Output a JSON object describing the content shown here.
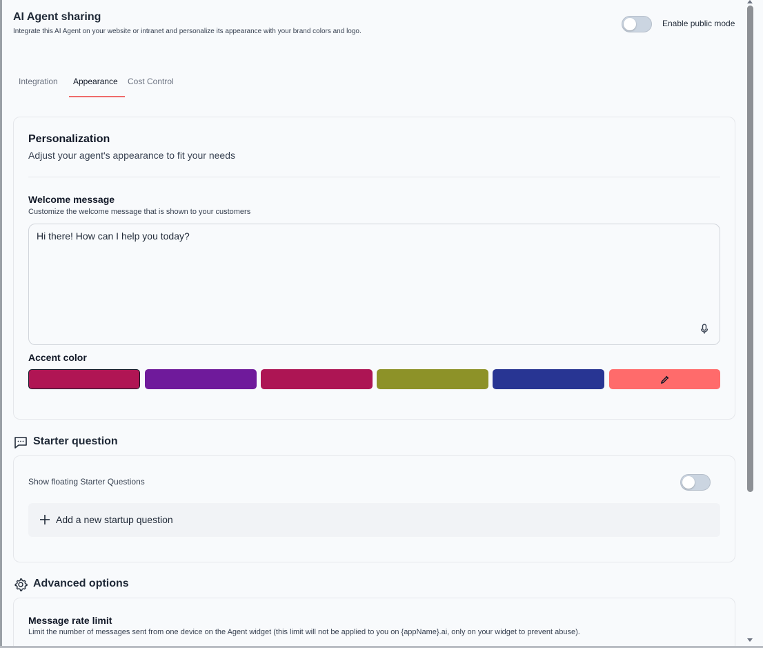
{
  "header": {
    "title": "AI Agent sharing",
    "subtitle": "Integrate this AI Agent on your website or intranet and personalize its appearance with your brand colors and logo.",
    "public_mode_label": "Enable public mode",
    "public_mode_enabled": false
  },
  "tabs": [
    {
      "label": "Integration",
      "active": false
    },
    {
      "label": "Appearance",
      "active": true
    },
    {
      "label": "Cost Control",
      "active": false
    }
  ],
  "personalization": {
    "title": "Personalization",
    "subtitle": "Adjust your agent's appearance to fit your needs",
    "welcome": {
      "title": "Welcome message",
      "subtitle": "Customize the welcome message that is shown to your customers",
      "value": "Hi there! How can I help you today?",
      "mic_icon": "microphone-icon"
    },
    "accent": {
      "title": "Accent color",
      "swatches": [
        "#b01554",
        "#6f1a9b",
        "#ad1554",
        "#8d9228",
        "#283593",
        "#ff6b6b"
      ],
      "selected_index": 0,
      "picker_icon": "eyedropper-icon"
    }
  },
  "starter": {
    "title": "Starter question",
    "icon": "message-square-icon",
    "floating_label": "Show floating Starter Questions",
    "floating_enabled": false,
    "add_label": "Add a new startup question",
    "add_icon": "plus-icon"
  },
  "advanced": {
    "title": "Advanced options",
    "icon": "gear-icon",
    "rate_title": "Message rate limit",
    "rate_subtitle": "Limit the number of messages sent from one device on the Agent widget (this limit will not be applied to you on {appName}.ai, only on your widget to prevent abuse)."
  },
  "colors": {
    "accent_tab": "#ef6b6b",
    "toggle_off": "#cbd5e1",
    "background": "#f8fafc"
  }
}
